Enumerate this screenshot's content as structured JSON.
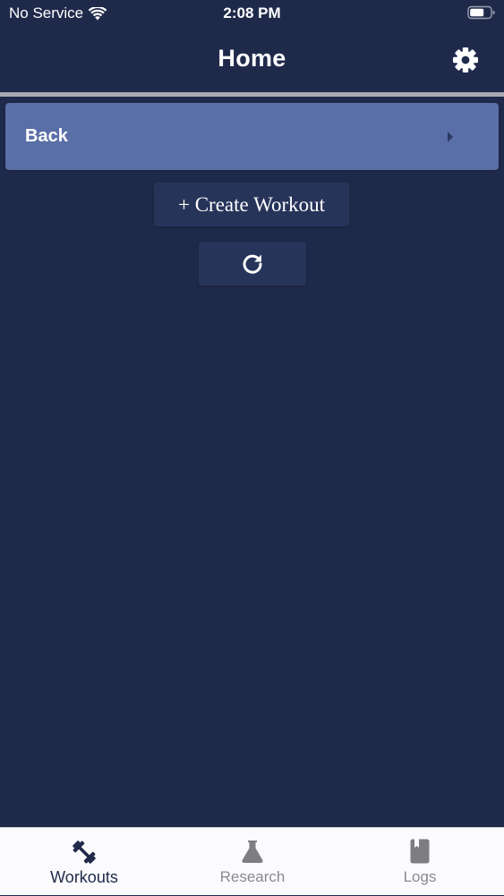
{
  "status_bar": {
    "carrier": "No Service",
    "time": "2:08 PM",
    "wifi_icon": "wifi-icon",
    "battery_icon": "battery-icon"
  },
  "header": {
    "title": "Home",
    "settings_icon": "gear-icon"
  },
  "main": {
    "back_row": {
      "label": "Back",
      "icon": "caret-right-icon"
    },
    "create_button": {
      "label": "+ Create Workout"
    },
    "refresh_button": {
      "icon": "refresh-icon"
    }
  },
  "tab_bar": {
    "tabs": [
      {
        "label": "Workouts",
        "icon": "dumbbell-icon",
        "active": true
      },
      {
        "label": "Research",
        "icon": "flask-icon",
        "active": false
      },
      {
        "label": "Logs",
        "icon": "book-icon",
        "active": false
      }
    ]
  },
  "colors": {
    "background": "#1f2a4b",
    "back_row": "#5a6ea8",
    "button": "#27345a",
    "divider": "#a7a9b1",
    "tab_bar": "#fbfbfd",
    "tab_active": "#1f2a4b",
    "tab_inactive": "#8a8a8f"
  }
}
